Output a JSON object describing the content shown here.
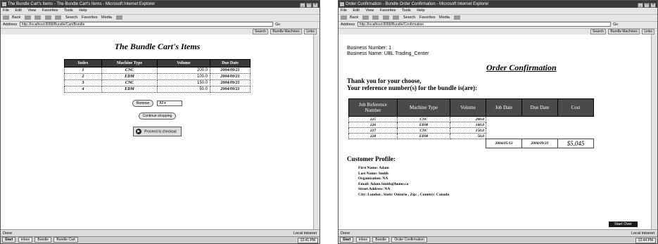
{
  "left_window": {
    "title": "The Bundle Cart's Items - The Bundle Cart's Items - Microsoft Internet Explorer",
    "menu": [
      "File",
      "Edit",
      "View",
      "Favorites",
      "Tools",
      "Help"
    ],
    "toolbar": [
      "Back",
      "Forward",
      "Stop",
      "Refresh",
      "Home",
      "Search",
      "Favorites",
      "Media",
      "History"
    ],
    "address_label": "Address",
    "address_value": "http://localhost:8088/Bundle/Cart/Bundle",
    "go_label": "Go",
    "links": [
      "Search",
      "Bundle Machines",
      "Links"
    ],
    "page": {
      "heading": "The Bundle Cart's Items",
      "columns": [
        "Index",
        "Machine Type",
        "Volume",
        "Due Date"
      ],
      "rows": [
        {
          "index": "1",
          "machine": "CNC",
          "volume": "200.0",
          "date": "2004/09/21"
        },
        {
          "index": "2",
          "machine": "EDM",
          "volume": "100.0",
          "date": "2004/09/21"
        },
        {
          "index": "3",
          "machine": "CNC",
          "volume": "150.0",
          "date": "2004/09/21"
        },
        {
          "index": "4",
          "machine": "EDM",
          "volume": "50.0",
          "date": "2004/09/21"
        }
      ],
      "remove_label": "Remove",
      "select_value": "All",
      "continue_label": "Continue shopping",
      "proceed_label": "Proceed to checkout"
    },
    "status_text": "Done",
    "status_zone": "Local intranet",
    "taskbar": [
      "Start",
      "Inbox",
      "Bundle",
      "Bundle Cart"
    ],
    "clock": "12:41 PM"
  },
  "right_window": {
    "title": "Order Confirmation - Bundle Order Confirmation - Microsoft Internet Explorer",
    "menu": [
      "File",
      "Edit",
      "View",
      "Favorites",
      "Tools",
      "Help"
    ],
    "toolbar": [
      "Back",
      "Forward",
      "Stop",
      "Refresh",
      "Home",
      "Search",
      "Favorites",
      "Media",
      "History"
    ],
    "address_label": "Address",
    "address_value": "http://localhost:8088/Bundle/Confirmation",
    "go_label": "Go",
    "links": [
      "Search",
      "Bundle Machines",
      "Links"
    ],
    "page": {
      "business_number": "Business Number: 1",
      "business_name": "Business Name: UBL Trading_Center",
      "heading": "Order Confirmation",
      "thanks_line1": "Thank you for your choose,",
      "thanks_line2": "Your reference number(s) for the bundle is(are):",
      "columns": [
        "Job Reference Number",
        "Machine Type",
        "Volume",
        "Job Date",
        "Due Date",
        "Cost"
      ],
      "rows": [
        {
          "ref": "225",
          "machine": "CNC",
          "volume": "200.0"
        },
        {
          "ref": "226",
          "machine": "EDM",
          "volume": "100.0"
        },
        {
          "ref": "227",
          "machine": "CNC",
          "volume": "150.0"
        },
        {
          "ref": "228",
          "machine": "EDM",
          "volume": "50.0"
        }
      ],
      "job_date": "2004/05/13",
      "due_date": "2004/09/21",
      "cost": "$5,045",
      "profile_heading": "Customer Profile:",
      "first_name": "First Name: Adam",
      "last_name": "Last Name: Smith",
      "organization": "Organization: NA",
      "email": "Email: Adam.Smith@home.ca",
      "street": "Street Address: NA",
      "city_line": "City: London , State: Ontario , Zip: , Country: Canada",
      "start_over_label": "Start Over"
    },
    "status_text": "Done",
    "status_zone": "Local intranet",
    "taskbar": [
      "Start",
      "Inbox",
      "Bundle",
      "Order Confirmation"
    ],
    "clock": "12:44 PM"
  }
}
